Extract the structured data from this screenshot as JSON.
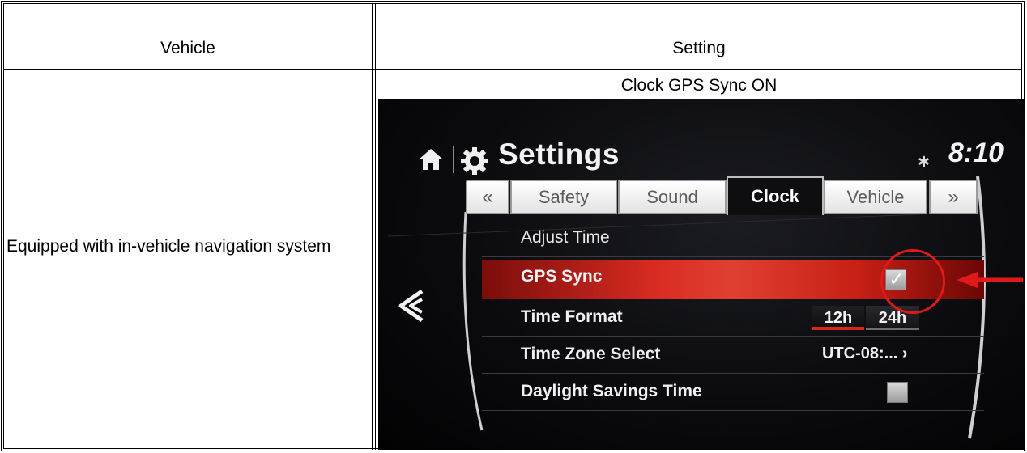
{
  "table": {
    "header_vehicle": "Vehicle",
    "header_setting": "Setting",
    "row_vehicle": "Equipped with in-vehicle navigation system",
    "row_caption": "Clock GPS Sync ON"
  },
  "screen": {
    "title": "Settings",
    "time": "8:10",
    "tabs": [
      "«",
      "Safety",
      "Sound",
      "Clock",
      "Vehicle",
      "»"
    ],
    "active_tab": "Clock",
    "rows": {
      "adjust_time": "Adjust Time",
      "gps_sync": "GPS Sync",
      "time_format": "Time Format",
      "format_12": "12h",
      "format_24": "24h",
      "time_zone": "Time Zone Select",
      "time_zone_value": "UTC-08:... ›",
      "daylight": "Daylight Savings Time"
    },
    "gps_sync_checked": true,
    "daylight_checked": false,
    "selected_format": "12h",
    "icons": [
      "home-icon",
      "gear-icon",
      "bluetooth-icon",
      "back-chevron-icon",
      "checkmark-icon"
    ],
    "colors": {
      "highlight": "#d92c22",
      "annotation": "#e01a1a"
    }
  }
}
